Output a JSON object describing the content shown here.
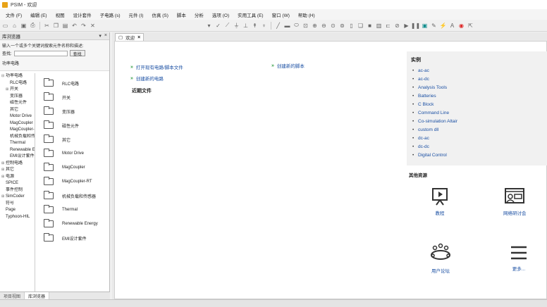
{
  "window": {
    "title": "PSIM - 欢迎"
  },
  "menu": [
    "文件 (F)",
    "编辑 (E)",
    "视图",
    "设计套件",
    "子电路 (s)",
    "元件 (I)",
    "仿真 (S)",
    "脚本",
    "分析",
    "选项 (O)",
    "实用工具 (E)",
    "窗口 (W)",
    "帮助 (H)"
  ],
  "library": {
    "header": "库浏览器",
    "search_hint": "输入一个或多个关键词搜索元件名称和描述:",
    "search_label": "查找:",
    "search_value": "",
    "search_button": "查找",
    "lib_label": "功率电路",
    "tree": [
      {
        "label": "功率电路",
        "exp": "⊟",
        "indent": 0
      },
      {
        "label": "RLC电路",
        "exp": "",
        "indent": 1
      },
      {
        "label": "开关",
        "exp": "⊞",
        "indent": 1
      },
      {
        "label": "变压器",
        "exp": "",
        "indent": 1
      },
      {
        "label": "磁性元件",
        "exp": "",
        "indent": 1
      },
      {
        "label": "其它",
        "exp": "",
        "indent": 1
      },
      {
        "label": "Motor Drive",
        "exp": "",
        "indent": 1
      },
      {
        "label": "MagCoupler",
        "exp": "",
        "indent": 1
      },
      {
        "label": "MagCoupler-RT",
        "exp": "",
        "indent": 1
      },
      {
        "label": "机械负载和传感器",
        "exp": "",
        "indent": 1
      },
      {
        "label": "Thermal",
        "exp": "",
        "indent": 1
      },
      {
        "label": "Renewable Energy",
        "exp": "",
        "indent": 1
      },
      {
        "label": "EMI设计套件",
        "exp": "",
        "indent": 1
      },
      {
        "label": "控制电路",
        "exp": "⊞",
        "indent": 0
      },
      {
        "label": "其它",
        "exp": "⊞",
        "indent": 0
      },
      {
        "label": "电源",
        "exp": "⊞",
        "indent": 0
      },
      {
        "label": "SPICE",
        "exp": "",
        "indent": 0
      },
      {
        "label": "事件控制",
        "exp": "",
        "indent": 0
      },
      {
        "label": "SimCoder",
        "exp": "⊞",
        "indent": 0
      },
      {
        "label": "符号",
        "exp": "",
        "indent": 0
      },
      {
        "label": "Page",
        "exp": "",
        "indent": 0
      },
      {
        "label": "Typhoon-HIL",
        "exp": "",
        "indent": 0
      }
    ],
    "folders": [
      "RLC电路",
      "开关",
      "变压器",
      "磁性元件",
      "其它",
      "Motor Drive",
      "MagCoupler",
      "MagCoupler-RT",
      "机械负载和传感器",
      "Thermal",
      "Renewable Energy",
      "EMI设计套件"
    ],
    "bottom_tabs": [
      "项目视图",
      "库浏览器"
    ]
  },
  "doc": {
    "tab_label": "欢迎",
    "tab_close": "×",
    "links": {
      "open_file": "打开现有电路/脚本文件",
      "new_script": "创建新的脚本",
      "new_circuit": "创建新的电路"
    },
    "recent_title": "近期文件",
    "examples_title": "实例",
    "examples": [
      "ac-ac",
      "ac-dc",
      "Analysis Tools",
      "Batteries",
      "C Block",
      "Command Line",
      "Co-simulation Altair",
      "custom dll",
      "dc-ac",
      "dc-dc",
      "Digital Control"
    ],
    "resources_title": "其他资源",
    "resources": [
      "教程",
      "网络研讨会",
      "用户论坛",
      "更多..."
    ]
  },
  "colors": {
    "link": "#1a4fa3",
    "arrow": "#3aa04a",
    "accent": "#e8a317"
  }
}
